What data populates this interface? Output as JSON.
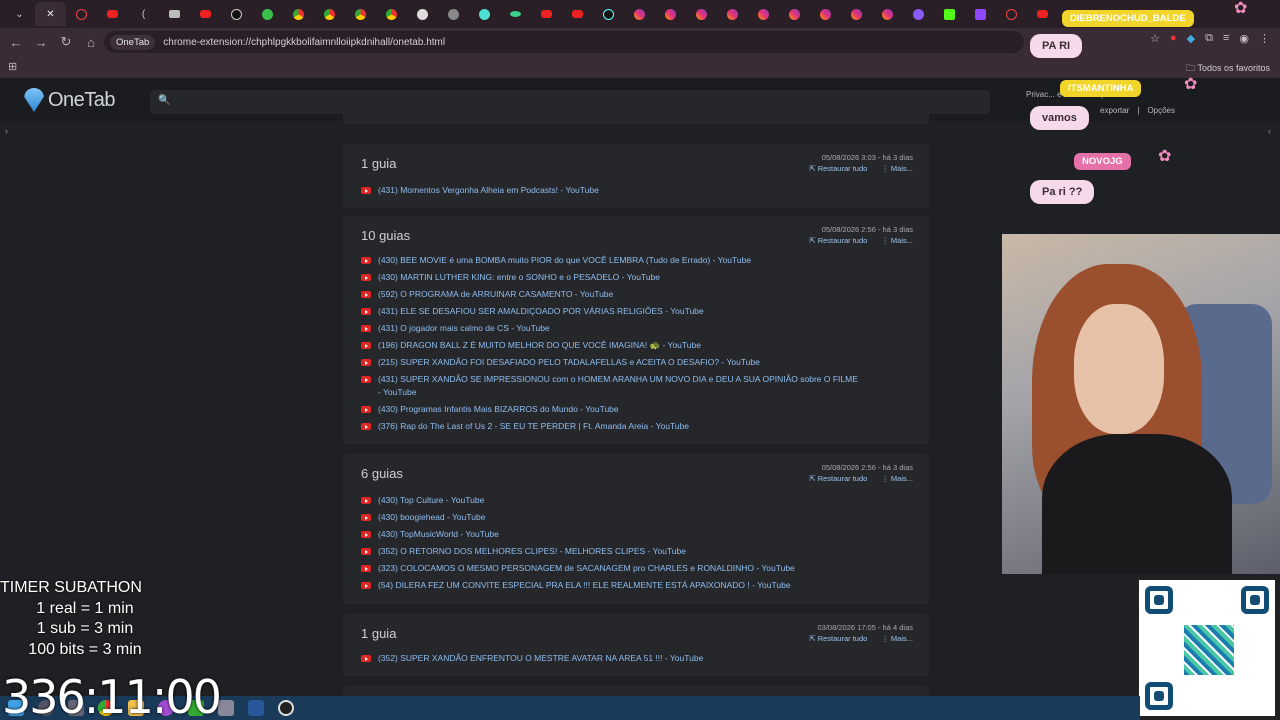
{
  "browser": {
    "tab_favicons": [
      "chevron-down",
      "close",
      "generic",
      "youtube",
      "youtube",
      "bracket",
      "youtube",
      "s-logo",
      "green",
      "chrome",
      "chrome",
      "chrome",
      "chrome",
      "download",
      "gear",
      "teal",
      "kick",
      "youtube",
      "youtube",
      "tiktok",
      "instagram",
      "instagram",
      "instagram",
      "instagram",
      "instagram",
      "instagram",
      "instagram",
      "instagram",
      "instagram",
      "purple",
      "green-k",
      "twitch",
      "red-circle",
      "youtube"
    ],
    "omnibox": {
      "chip": "OneTab",
      "url": "chrome-extension://chphlpgkkbolifaimnlloiipkdnihall/onetab.html"
    },
    "bookmarks_all": "Todos os favoritos"
  },
  "onetab": {
    "logo_text": "OneTab",
    "links_top": "Privac...          e sincronização",
    "links_bottom": [
      "exportar",
      "Opções"
    ]
  },
  "groups": [
    {
      "count": "1 guia",
      "date": "05/08/2026 3:03 - há 3 dias",
      "restore": "Restaurar tudo",
      "more": "Mais...",
      "tabs": [
        "(431) Momentos Vergonha Alheia em Podcasts! - YouTube"
      ]
    },
    {
      "count": "10 guias",
      "date": "05/08/2026 2:56 - há 3 dias",
      "restore": "Restaurar tudo",
      "more": "Mais...",
      "tabs": [
        "(430) BEE MOVIE é uma BOMBA muito PIOR do que VOCÊ LEMBRA (Tudo de Errado) - YouTube",
        "(430) MARTIN LUTHER KING: entre o SONHO e o PESADELO - YouTube",
        "(592) O PROGRAMA de ARRUINAR CASAMENTO - YouTube",
        "(431) ELE SE DESAFIOU SER AMALDIÇOADO POR VÁRIAS RELIGIÕES - YouTube",
        "(431) O jogador mais calmo de CS - YouTube",
        "(196) DRAGON BALL Z É MUITO MELHOR DO QUE VOCÊ IMAGINA! 🐢 - YouTube",
        "(215) SUPER XANDÃO FOI DESAFIADO PELO TADALAFELLAS e ACEITA O DESAFIO? - YouTube",
        "(431) SUPER XANDÃO SE IMPRESSIONOU com o HOMEM ARANHA UM NOVO DIA e DEU A SUA OPINIÃO sobre O FILME - YouTube",
        "(430) Programas Infantis Mais BIZARROS do Mundo - YouTube",
        "(376) Rap do The Last of Us 2 - SE EU TE PERDER | Ft. Amanda Areia - YouTube"
      ]
    },
    {
      "count": "6 guias",
      "date": "05/08/2026 2:56 - há 3 dias",
      "restore": "Restaurar tudo",
      "more": "Mais...",
      "tabs": [
        "(430) Top Culture - YouTube",
        "(430) boogiehead - YouTube",
        "(430) TopMusicWorld - YouTube",
        "(352) O RETORNO DOS MELHORES CLIPES! - MELHORES CLIPES - YouTube",
        "(323) COLOCAMOS O MESMO PERSONAGEM de SACANAGEM pro CHARLES e RONALDINHO - YouTube",
        "(54) DILERA FEZ UM CONVITE ESPECIAL PRA ELA !!! ELE REALMENTE ESTÁ APAIXONADO ! - YouTube"
      ]
    },
    {
      "count": "1 guia",
      "date": "03/08/2026 17:05 - há 4 dias",
      "restore": "Restaurar tudo",
      "more": "Mais...",
      "tabs": [
        "(352) SUPER XANDÃO ENFRENTOU O MESTRE AVATAR NA AREA 51 !!! - YouTube"
      ]
    }
  ],
  "chat": [
    {
      "user": "DIEBRENOCHUD_BALDE",
      "message": "PA RI"
    },
    {
      "user": "ITSMANTINHA",
      "message": "vamos"
    },
    {
      "user": "NOVOJG",
      "message": "Pa ri ??"
    }
  ],
  "subathon": {
    "title": "TIMER SUBATHON",
    "rules": [
      "1 real = 1 min",
      "1 sub = 3 min",
      "100 bits = 3 min"
    ],
    "timer": "336:11:00"
  }
}
